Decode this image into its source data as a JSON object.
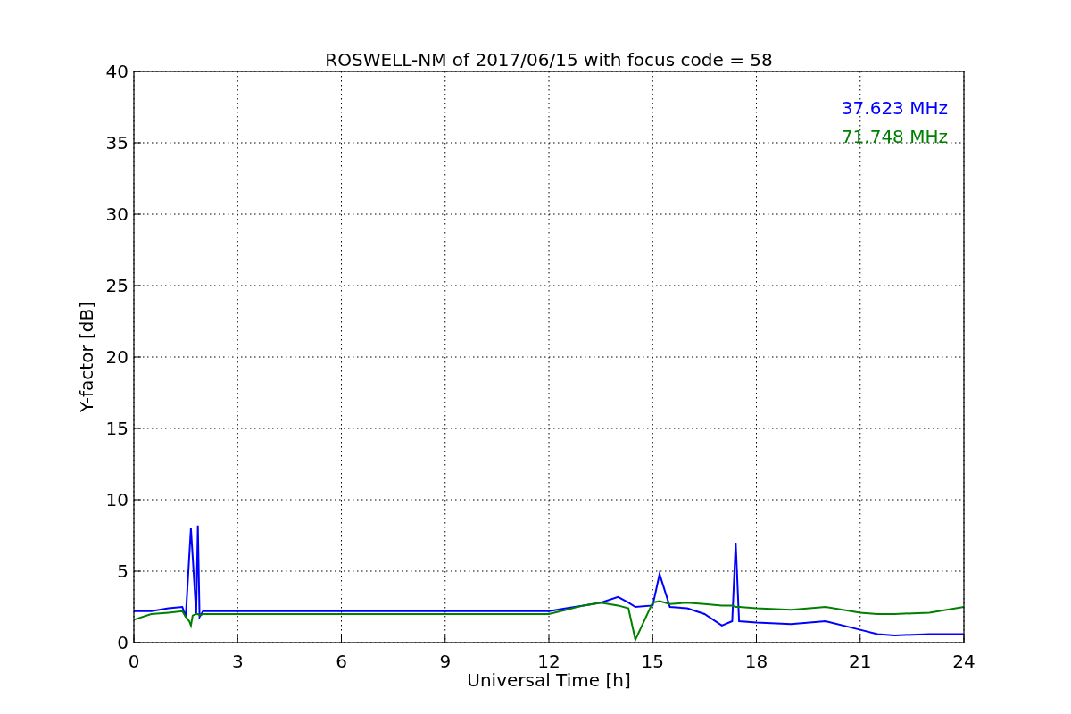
{
  "chart": {
    "chart_data": {
      "type": "line",
      "title": "ROSWELL-NM of 2017/06/15 with focus code = 58",
      "xlabel": "Universal Time [h]",
      "ylabel": "Y-factor [dB]",
      "x": [
        0,
        0.5,
        1,
        1.4,
        1.5,
        1.6,
        1.65,
        1.7,
        1.8,
        1.85,
        1.9,
        2,
        12,
        12.5,
        13,
        13.5,
        14,
        14.3,
        14.5,
        15,
        15.2,
        15.5,
        16,
        16.5,
        17,
        17.3,
        17.4,
        17.5,
        18,
        19,
        20,
        21,
        21.5,
        22,
        23,
        24
      ],
      "series": [
        {
          "name": "37.623 MHz",
          "color": "#0000ff",
          "values": [
            2.2,
            2.2,
            2.4,
            2.5,
            1.8,
            6,
            8,
            6,
            2,
            8.2,
            1.8,
            2.2,
            2.2,
            2.4,
            2.6,
            2.8,
            3.2,
            2.8,
            2.5,
            2.6,
            4.8,
            2.5,
            2.4,
            2.0,
            1.2,
            1.5,
            7,
            1.5,
            1.4,
            1.3,
            1.5,
            0.9,
            0.6,
            0.5,
            0.6,
            0.6
          ]
        },
        {
          "name": "71.748 MHz",
          "color": "#008000",
          "values": [
            1.6,
            2.0,
            2.1,
            2.2,
            1.8,
            1.5,
            1.2,
            1.9,
            2.0,
            2.0,
            1.9,
            2.0,
            2.0,
            2.3,
            2.6,
            2.8,
            2.6,
            2.4,
            0.2,
            2.8,
            2.9,
            2.7,
            2.8,
            2.7,
            2.6,
            2.6,
            2.5,
            2.5,
            2.4,
            2.3,
            2.5,
            2.1,
            2.0,
            2.0,
            2.1,
            2.5
          ]
        }
      ],
      "xlim": [
        0,
        24
      ],
      "ylim": [
        0,
        40
      ],
      "xticks": [
        0,
        3,
        6,
        9,
        12,
        15,
        18,
        21,
        24
      ],
      "yticks": [
        0,
        5,
        10,
        15,
        20,
        25,
        30,
        35,
        40
      ],
      "grid": true
    }
  }
}
